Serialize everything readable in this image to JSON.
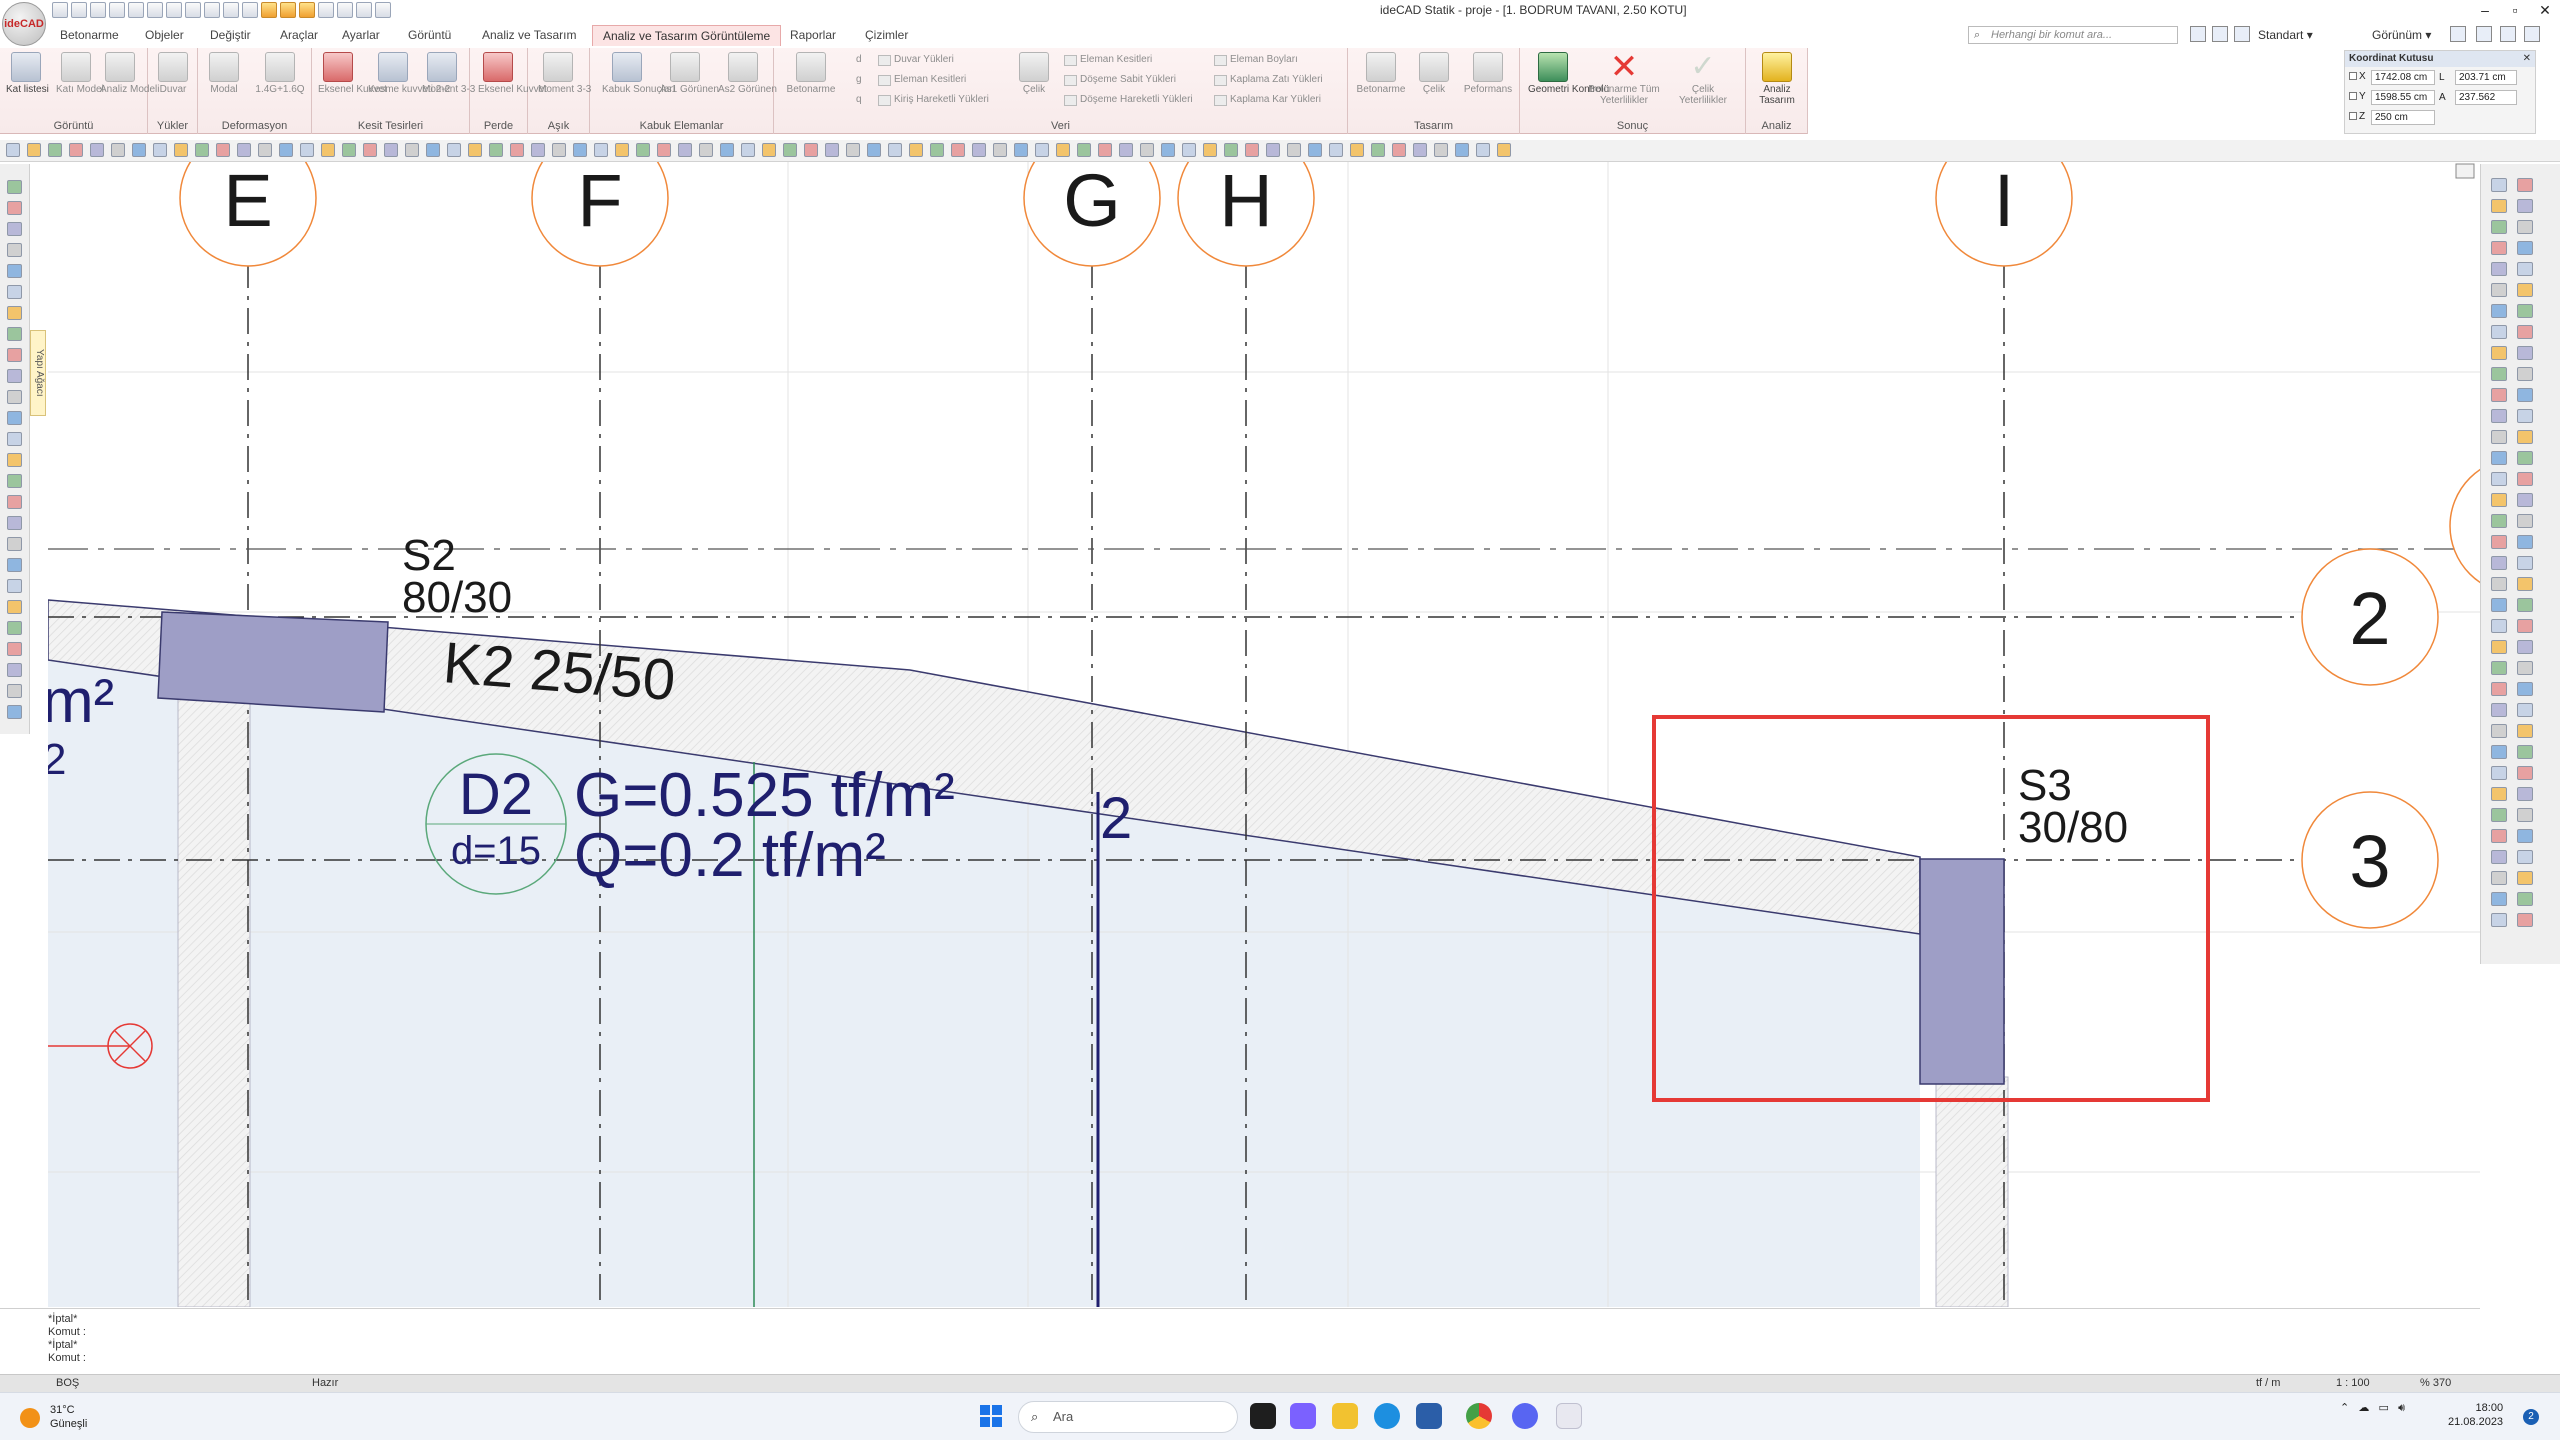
{
  "app": {
    "logo_text": "ideCAD",
    "window_title": "ideCAD Statik - proje - [1. BODRUM TAVANI,  2.50 KOTU]"
  },
  "menu": {
    "tabs": [
      "Betonarme",
      "Objeler",
      "Değiştir",
      "Araçlar",
      "Ayarlar",
      "Görüntü",
      "Analiz ve Tasarım",
      "Analiz ve Tasarım Görüntüleme",
      "Raporlar",
      "Çizimler"
    ],
    "active_tab": "Analiz ve Tasarım Görüntüleme",
    "search_placeholder": "Herhangi bir komut ara...",
    "style_label": "Standart",
    "view_label": "Görünüm"
  },
  "ribbon": {
    "groups": [
      {
        "label": "Görüntü",
        "buttons": [
          "Kat listesi",
          "Katı Model",
          "Analiz Modeli"
        ]
      },
      {
        "label": "Yükler",
        "buttons": [
          "Duvar"
        ]
      },
      {
        "label": "Deformasyon",
        "buttons": [
          "Modal",
          "1.4G+1.6Q"
        ]
      },
      {
        "label": "Kesit Tesirleri",
        "buttons": [
          "Eksenel Kuvvet",
          "Kesme kuvveti 2-2",
          "Moment 3-3"
        ]
      },
      {
        "label": "Perde",
        "buttons": [
          "Eksenel Kuvvet"
        ]
      },
      {
        "label": "Aşık",
        "buttons": [
          "Moment 3-3"
        ]
      },
      {
        "label": "Kabuk Elemanlar",
        "buttons": [
          "Kabuk Sonuçları",
          "As1 Görünen",
          "As2 Görünen"
        ]
      },
      {
        "label": "Veri",
        "buttons": [
          "Betonarme",
          "Çelik"
        ]
      },
      {
        "label": "Tasarım",
        "buttons": [
          "Betonarme",
          "Çelik",
          "Peformans"
        ]
      },
      {
        "label": "Sonuç",
        "buttons": [
          "Geometri Kontrolü",
          "Betonarme Tüm Yeterlilikler",
          "Çelik Yeterlilikler"
        ]
      },
      {
        "label": "Analiz",
        "buttons": [
          "Analiz Tasarım"
        ]
      }
    ],
    "veri_small_items": {
      "col1": [
        "Duvar Yükleri",
        "Eleman Kesitleri",
        "Kiriş Hareketli Yükleri"
      ],
      "col1_letters": [
        "d",
        "g",
        "q"
      ],
      "col2": [
        "Eleman Kesitleri",
        "Döşeme Sabit Yükleri",
        "Döşeme Hareketli Yükleri"
      ],
      "col3": [
        "Eleman Boyları",
        "Kaplama Zatı Yükleri",
        "Kaplama Kar Yükleri"
      ]
    }
  },
  "coord_box": {
    "title": "Koordinat Kutusu",
    "x_label": "X",
    "x_value": "1742.08 cm",
    "y_label": "Y",
    "y_value": "1598.55 cm",
    "z_label": "Z",
    "z_value": "250 cm",
    "l_label": "L",
    "l_value": "203.71 cm",
    "a_label": "A",
    "a_value": "237.562"
  },
  "left_palette": {
    "tab_label": "Yapı Ağacı"
  },
  "drawing": {
    "axes_vertical": [
      "E",
      "F",
      "G",
      "H",
      "I"
    ],
    "axes_horizontal": [
      "2",
      "3"
    ],
    "column_s2": {
      "name": "S2",
      "size": "80/30"
    },
    "column_s3": {
      "name": "S3",
      "size": "30/80"
    },
    "beam_k2": "K2 25/50",
    "slab": {
      "name": "D2",
      "thickness": "d=15",
      "g_load": "G=0.525 tf/m²",
      "q_load": "Q=0.2 tf/m²"
    },
    "partial_left_text": "m²",
    "partial_left_text2": "2",
    "small_label": "2",
    "highlight_color": "#e53935",
    "axis_bubble_color": "#f0883a",
    "slab_text_color": "#1f1f6e",
    "column_fill": "#9e9ec6"
  },
  "command": {
    "lines": [
      "*İptal*",
      "Komut :",
      "*İptal*",
      "Komut :"
    ]
  },
  "statusbar": {
    "left": "BOŞ",
    "state": "Hazır",
    "unit": "tf / m",
    "scale": "1 : 100",
    "zoom": "% 370"
  },
  "taskbar": {
    "temperature": "31°C",
    "weather": "Güneşli",
    "search_placeholder": "Ara",
    "time": "18:00",
    "date": "21.08.2023",
    "notifications": "2"
  }
}
